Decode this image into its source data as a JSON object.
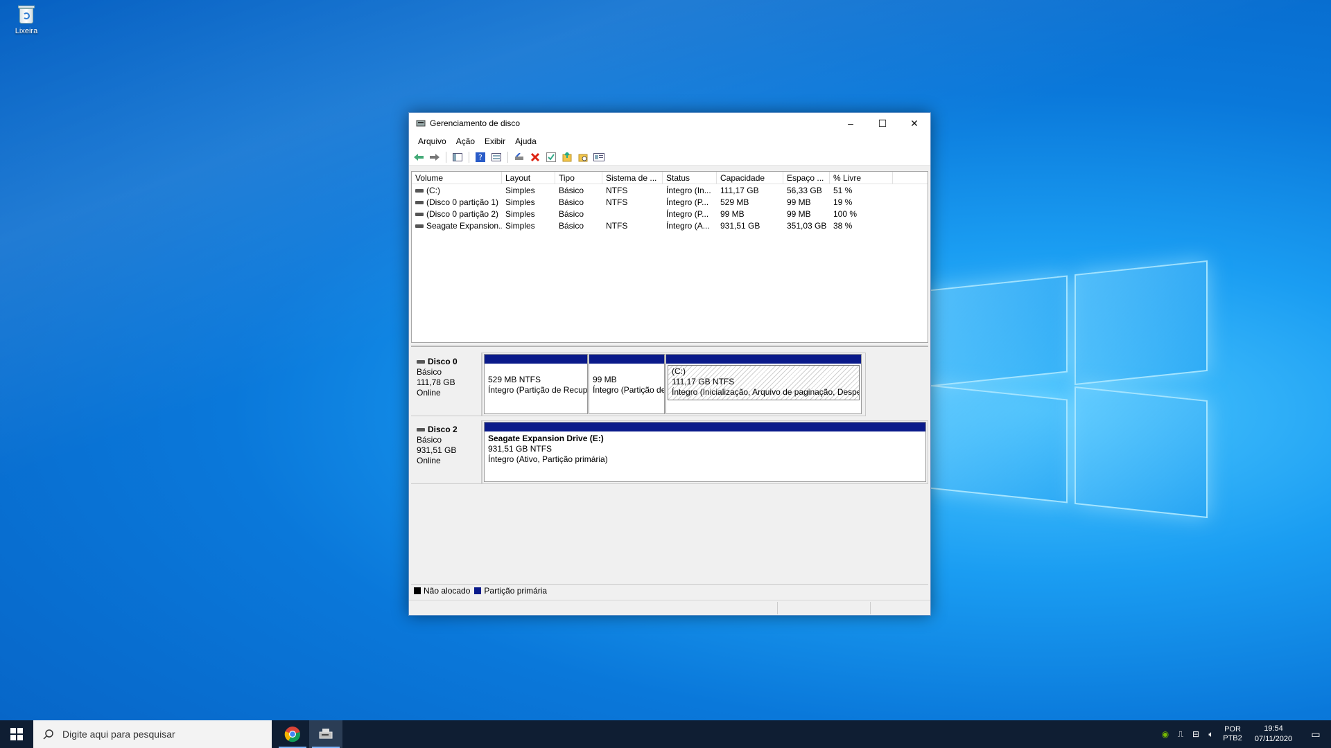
{
  "desktop": {
    "recycle_bin_label": "Lixeira"
  },
  "window": {
    "title": "Gerenciamento de disco",
    "minimize": "–",
    "maximize": "☐",
    "close": "✕"
  },
  "menu": [
    "Arquivo",
    "Ação",
    "Exibir",
    "Ajuda"
  ],
  "volumes": {
    "headers": [
      "Volume",
      "Layout",
      "Tipo",
      "Sistema de ...",
      "Status",
      "Capacidade",
      "Espaço ...",
      "% Livre"
    ],
    "rows": [
      [
        "(C:)",
        "Simples",
        "Básico",
        "NTFS",
        "Íntegro (In...",
        "111,17 GB",
        "56,33 GB",
        "51 %"
      ],
      [
        "(Disco 0 partição 1)",
        "Simples",
        "Básico",
        "NTFS",
        "Íntegro (P...",
        "529 MB",
        "99 MB",
        "19 %"
      ],
      [
        "(Disco 0 partição 2)",
        "Simples",
        "Básico",
        "",
        "Íntegro (P...",
        "99 MB",
        "99 MB",
        "100 %"
      ],
      [
        "Seagate Expansion...",
        "Simples",
        "Básico",
        "NTFS",
        "Íntegro (A...",
        "931,51 GB",
        "351,03 GB",
        "38 %"
      ]
    ]
  },
  "disks": [
    {
      "name": "Disco 0",
      "type": "Básico",
      "size": "111,78 GB",
      "state": "Online",
      "partitions": [
        {
          "title": "",
          "size": "529 MB NTFS",
          "status": "Íntegro (Partição de Recuperação)"
        },
        {
          "title": "",
          "size": "99 MB",
          "status": "Íntegro (Partição de Sistema EFI)"
        },
        {
          "title": "(C:)",
          "size": "111,17 GB NTFS",
          "status": "Íntegro (Inicialização, Arquivo de paginação, Despejo de Memória, Partição primária)"
        }
      ]
    },
    {
      "name": "Disco 2",
      "type": "Básico",
      "size": "931,51 GB",
      "state": "Online",
      "partitions": [
        {
          "title": "Seagate Expansion Drive  (E:)",
          "size": "931,51 GB NTFS",
          "status": "Íntegro (Ativo, Partição primária)"
        }
      ]
    }
  ],
  "legend": [
    {
      "label": "Não alocado",
      "color": "#000000"
    },
    {
      "label": "Partição primária",
      "color": "#0a1a8a"
    }
  ],
  "taskbar": {
    "search_placeholder": "Digite aqui para pesquisar",
    "lang_top": "POR",
    "lang_bottom": "PTB2",
    "time": "19:54",
    "date": "07/11/2020"
  }
}
